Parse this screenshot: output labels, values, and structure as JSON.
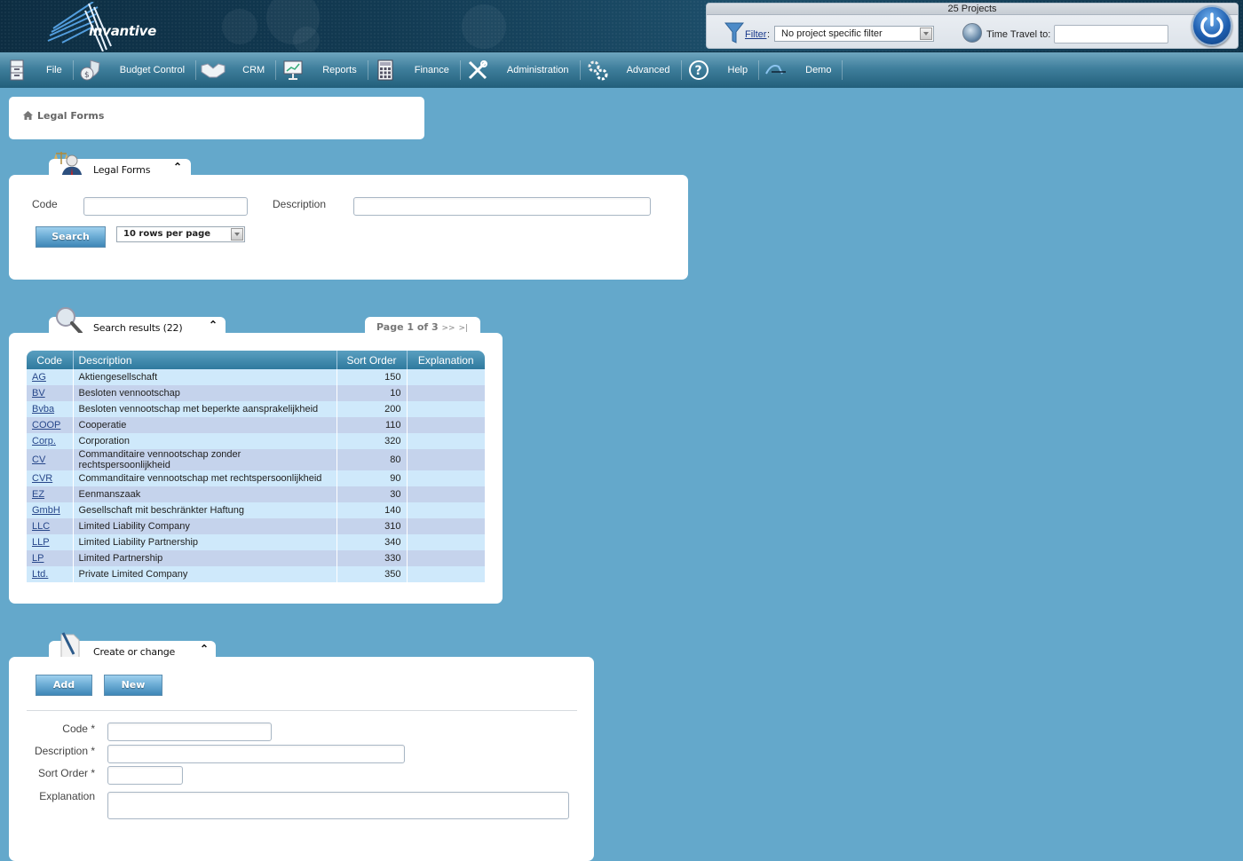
{
  "header": {
    "logo_text": "invantive",
    "project_count": "25 Projects",
    "filter_link": "Filter",
    "filter_colon": ":",
    "filter_value": "No project specific filter",
    "time_travel_label": "Time Travel to:",
    "time_travel_value": ""
  },
  "nav": {
    "items": [
      {
        "label": "File",
        "icon": "file-cabinet-icon"
      },
      {
        "label": "Budget Control",
        "icon": "money-bag-shield-icon"
      },
      {
        "label": "CRM",
        "icon": "handshake-icon"
      },
      {
        "label": "Reports",
        "icon": "presentation-chart-icon"
      },
      {
        "label": "Finance",
        "icon": "calculator-icon"
      },
      {
        "label": "Administration",
        "icon": "wrench-screwdriver-icon"
      },
      {
        "label": "Advanced",
        "icon": "gears-icon"
      },
      {
        "label": "Help",
        "icon": "question-circle-icon"
      },
      {
        "label": "Demo",
        "icon": "demo-logo-icon"
      }
    ]
  },
  "breadcrumb": {
    "label": "Legal Forms"
  },
  "search_panel": {
    "title": "Legal Forms",
    "code_label": "Code",
    "code_value": "",
    "description_label": "Description",
    "description_value": "",
    "search_button": "Search",
    "rows_per_page": "10 rows per page"
  },
  "results_panel": {
    "title": "Search results (22)",
    "pager": {
      "text": "Page 1 of 3",
      "next": ">>",
      "last": ">|"
    },
    "columns": [
      "Code",
      "Description",
      "Sort Order",
      "Explanation"
    ],
    "rows": [
      {
        "code": "AG",
        "description": "Aktiengesellschaft",
        "sort_order": "150",
        "explanation": ""
      },
      {
        "code": "BV",
        "description": "Besloten vennootschap",
        "sort_order": "10",
        "explanation": ""
      },
      {
        "code": "Bvba",
        "description": "Besloten vennootschap met beperkte aansprakelijkheid",
        "sort_order": "200",
        "explanation": ""
      },
      {
        "code": "COOP",
        "description": "Cooperatie",
        "sort_order": "110",
        "explanation": ""
      },
      {
        "code": "Corp.",
        "description": "Corporation",
        "sort_order": "320",
        "explanation": ""
      },
      {
        "code": "CV",
        "description": "Commanditaire vennootschap zonder rechtspersoonlijkheid",
        "sort_order": "80",
        "explanation": ""
      },
      {
        "code": "CVR",
        "description": "Commanditaire vennootschap met rechtspersoonlijkheid",
        "sort_order": "90",
        "explanation": ""
      },
      {
        "code": "EZ",
        "description": "Eenmanszaak",
        "sort_order": "30",
        "explanation": ""
      },
      {
        "code": "GmbH",
        "description": "Gesellschaft mit beschränkter Haftung",
        "sort_order": "140",
        "explanation": ""
      },
      {
        "code": "LLC",
        "description": "Limited Liability Company",
        "sort_order": "310",
        "explanation": ""
      },
      {
        "code": "LLP",
        "description": "Limited Liability Partnership",
        "sort_order": "340",
        "explanation": ""
      },
      {
        "code": "LP",
        "description": "Limited Partnership",
        "sort_order": "330",
        "explanation": ""
      },
      {
        "code": "Ltd.",
        "description": "Private Limited Company",
        "sort_order": "350",
        "explanation": ""
      }
    ]
  },
  "edit_panel": {
    "title": "Create or change",
    "add_button": "Add",
    "new_button": "New",
    "code_label": "Code *",
    "description_label": "Description *",
    "sort_order_label": "Sort Order *",
    "explanation_label": "Explanation",
    "code_value": "",
    "description_value": "",
    "sort_order_value": "",
    "explanation_value": ""
  },
  "colors": {
    "page_bg": "#64a8cb",
    "nav_bg": "#3f7f9c",
    "header_bg": "#123a52",
    "table_header": "#2f7a9e",
    "row_odd": "#cfe9fb",
    "row_even": "#c5d3ec",
    "link": "#27478a"
  }
}
